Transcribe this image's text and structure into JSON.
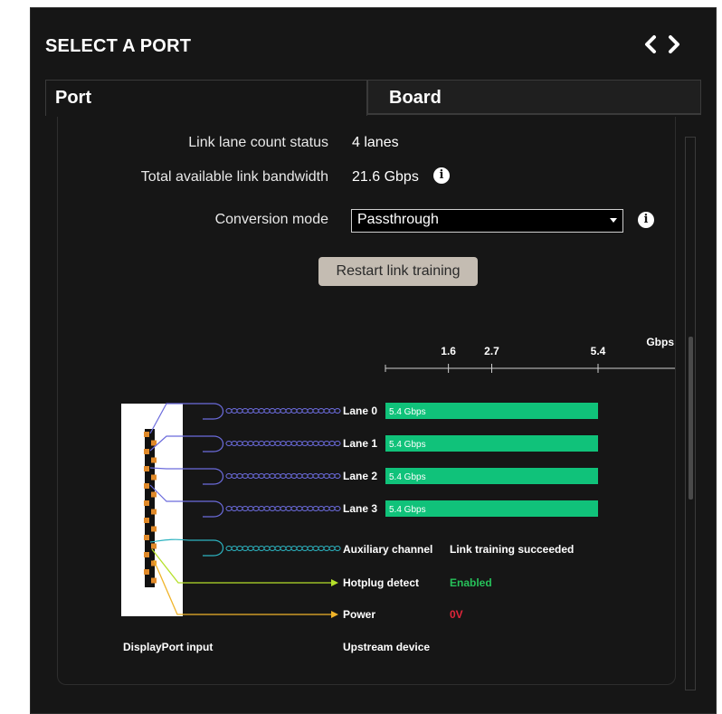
{
  "panel": {
    "title": "SELECT A PORT"
  },
  "nav": {
    "prev_icon": "chevron-left-icon",
    "next_icon": "chevron-right-icon"
  },
  "tabs": [
    {
      "label": "Port",
      "active": true
    },
    {
      "label": "Board",
      "active": false
    }
  ],
  "rows": {
    "lane_count": {
      "label": "Link lane count status",
      "value": "4 lanes"
    },
    "bandwidth": {
      "label": "Total available link bandwidth",
      "value": "21.6 Gbps"
    },
    "conversion": {
      "label": "Conversion mode",
      "value": "Passthrough"
    }
  },
  "restart_button": "Restart link training",
  "chart": {
    "unit": "Gbps",
    "ticks": [
      "1.6",
      "2.7",
      "5.4"
    ],
    "lanes": [
      {
        "label": "Lane 0",
        "rate_text": "5.4 Gbps",
        "rate": 5.4
      },
      {
        "label": "Lane 1",
        "rate_text": "5.4 Gbps",
        "rate": 5.4
      },
      {
        "label": "Lane 2",
        "rate_text": "5.4 Gbps",
        "rate": 5.4
      },
      {
        "label": "Lane 3",
        "rate_text": "5.4 Gbps",
        "rate": 5.4
      }
    ],
    "aux": {
      "label": "Auxiliary channel",
      "status": "Link training succeeded"
    },
    "hotplug": {
      "label": "Hotplug detect",
      "status": "Enabled"
    },
    "power": {
      "label": "Power",
      "status": "0V"
    },
    "input_label": "DisplayPort input",
    "device_label": "Upstream device"
  },
  "colors": {
    "lane_wire": "#6b6bdc",
    "aux_wire": "#2cb3c0",
    "bar": "#10c27a",
    "hotplug_wire": "#b5e02a",
    "power_wire": "#f0b429",
    "enabled": "#26c15a",
    "power_off": "#e0263a"
  }
}
